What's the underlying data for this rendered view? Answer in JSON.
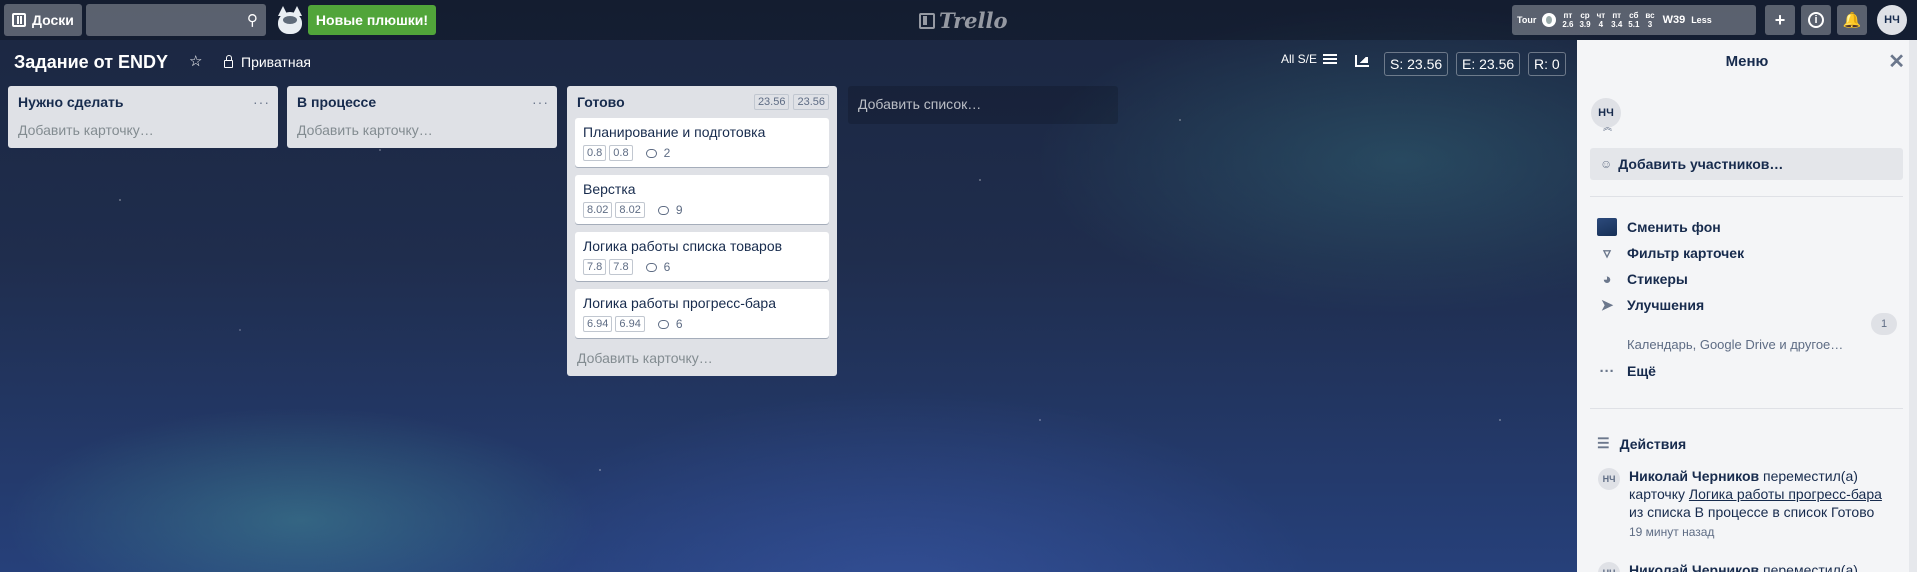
{
  "topbar": {
    "boards_label": "Доски",
    "search_placeholder": "",
    "promo_label": "Новые плюшки!",
    "logo_text": "Trello",
    "weather": {
      "tour_label": "Tour",
      "days": [
        {
          "day": "пт",
          "value": "2.6"
        },
        {
          "day": "ср",
          "value": "3.9"
        },
        {
          "day": "чт",
          "value": "4"
        },
        {
          "day": "пт",
          "value": "3.4"
        },
        {
          "day": "сб",
          "value": "5.1"
        },
        {
          "day": "вс",
          "value": "3"
        }
      ],
      "week_label": "W39",
      "less_label": "Less"
    },
    "add_label": "+",
    "info_label": "i",
    "notify_label": "",
    "avatar_initials": "НЧ"
  },
  "board": {
    "title": "Задание от ENDY",
    "star": "☆",
    "privacy_label": "Приватная",
    "se_all_label": "All S/E",
    "s_label": "S: 23.56",
    "e_label": "E: 23.56",
    "r_label": "R: 0"
  },
  "lists": [
    {
      "title": "Нужно сделать",
      "add_card": "Добавить карточку…",
      "cards": []
    },
    {
      "title": "В процессе",
      "add_card": "Добавить карточку…",
      "cards": []
    },
    {
      "title": "Готово",
      "sum_s": "23.56",
      "sum_e": "23.56",
      "add_card": "Добавить карточку…",
      "cards": [
        {
          "title": "Планирование и подготовка",
          "s": "0.8",
          "e": "0.8",
          "comments": "2"
        },
        {
          "title": "Верстка",
          "s": "8.02",
          "e": "8.02",
          "comments": "9"
        },
        {
          "title": "Логика работы списка товаров",
          "s": "7.8",
          "e": "7.8",
          "comments": "6"
        },
        {
          "title": "Логика работы прогресс-бара",
          "s": "6.94",
          "e": "6.94",
          "comments": "6"
        }
      ]
    }
  ],
  "add_list_label": "Добавить список…",
  "menu": {
    "title": "Меню",
    "member_initials": "НЧ",
    "add_members_label": "Добавить участников…",
    "items": [
      {
        "label": "Сменить фон"
      },
      {
        "label": "Фильтр карточек"
      },
      {
        "label": "Стикеры"
      },
      {
        "label": "Улучшения",
        "sub": "Календарь, Google Drive и другое…",
        "count": "1"
      },
      {
        "label": "Ещё"
      }
    ],
    "activity_title": "Действия",
    "activity": [
      {
        "initials": "НЧ",
        "user": "Николай Черников",
        "action": "переместил(а) карточку",
        "card": "Логика работы прогресс-бара",
        "rest": "из списка В процессе в список Готово",
        "time": "19 минут назад"
      },
      {
        "initials": "НЧ",
        "user": "Николай Черников",
        "action": "переместил(а)"
      }
    ]
  },
  "colors": {
    "promo": "#51a53a",
    "list_bg": "#dfe1e6",
    "menu_bg": "#f4f5f7"
  }
}
